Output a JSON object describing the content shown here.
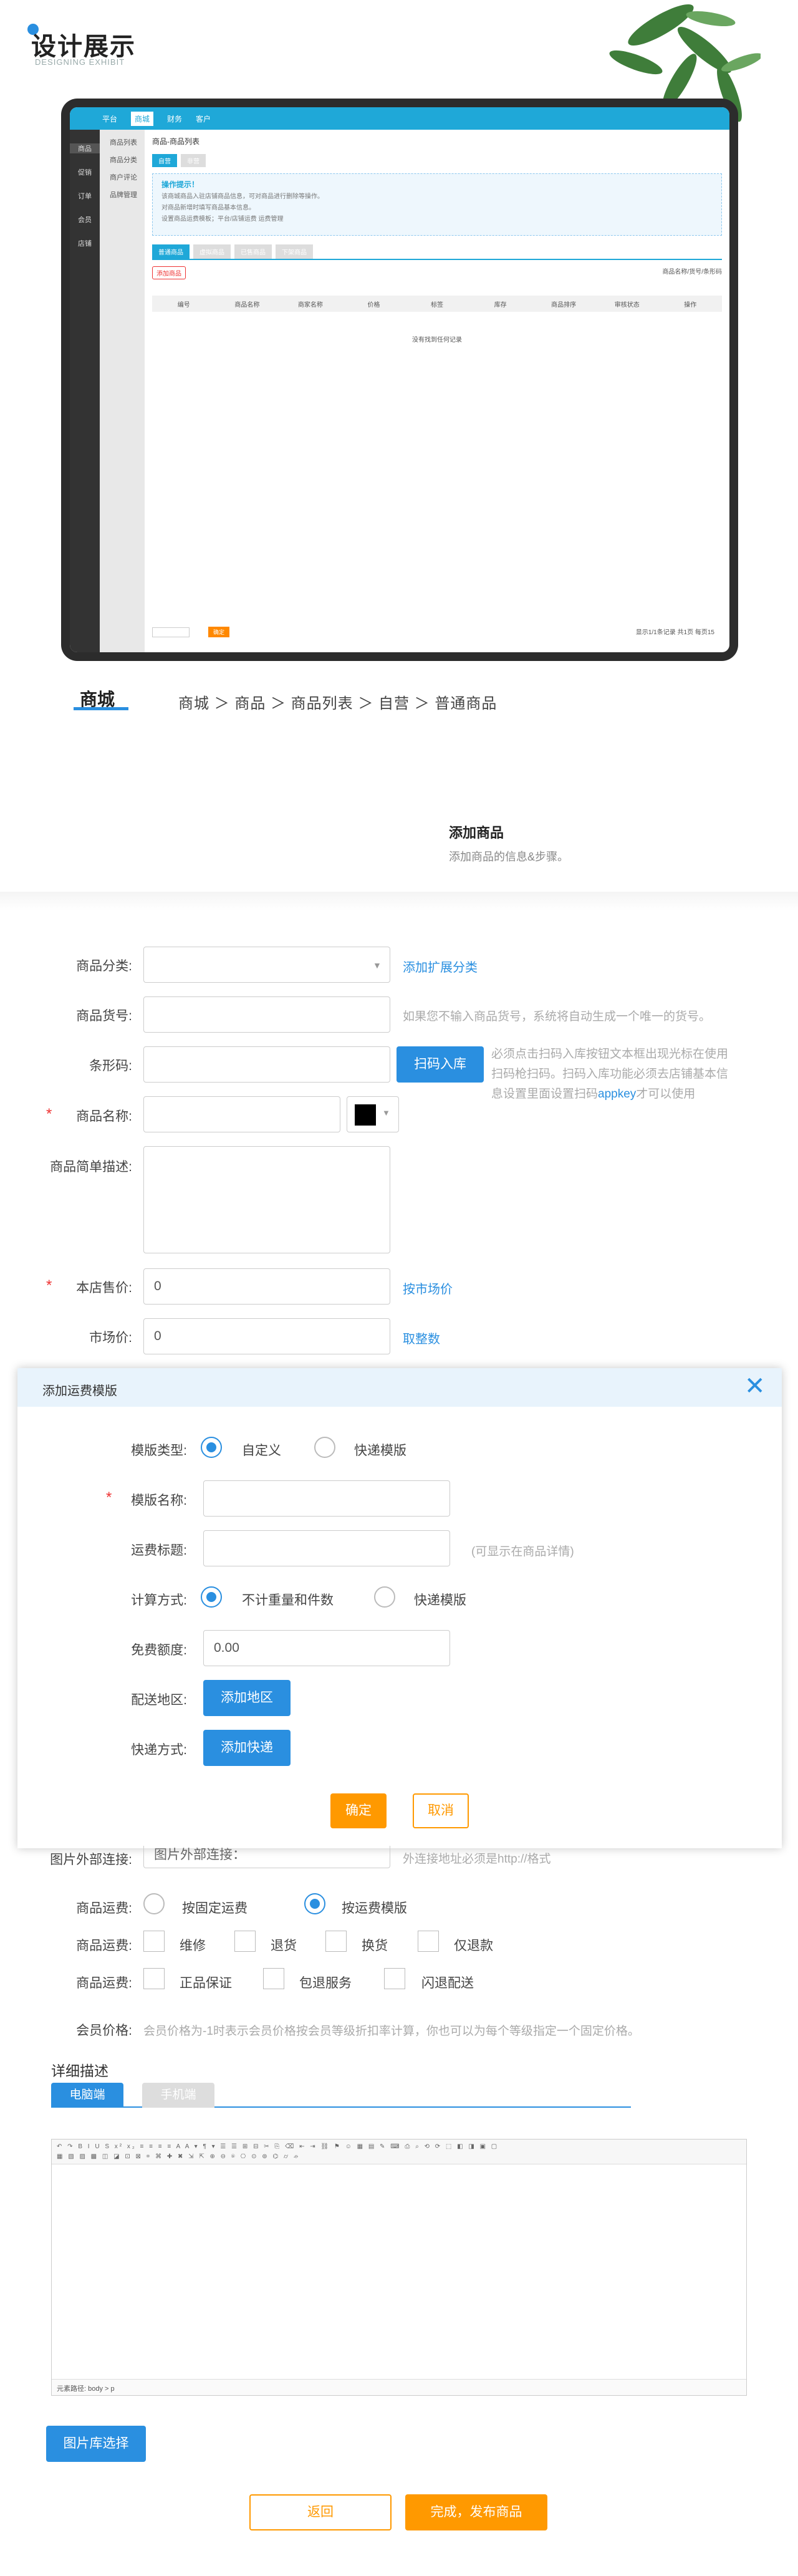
{
  "header": {
    "title": "设计展示",
    "subtitle": "DESIGNING EXHIBIT"
  },
  "mock": {
    "top_nav": [
      "平台",
      "商城",
      "财务",
      "客户"
    ],
    "left_nav": [
      "商品",
      "促销",
      "订单",
      "会员",
      "店铺"
    ],
    "sub_nav": [
      "商品列表",
      "商品分类",
      "商户评论",
      "品牌管理"
    ],
    "page_title": "商品-商品列表",
    "tabs": [
      "自营",
      "非营"
    ],
    "tip_title": "操作提示！",
    "tip_lines": [
      "该商城商品入驻店铺商品信息，可对商品进行删除等操作。",
      "对商品新增时填写商品基本信息。",
      "设置商品运费模板；平台/店铺运费 运费管理"
    ],
    "list_tabs": [
      "普通商品",
      "虚拟商品",
      "已售商品",
      "下架商品"
    ],
    "add_btn": "添加商品",
    "search_hint": "商品名称/货号/条形码",
    "columns": [
      "编号",
      "商品名称",
      "商家名称",
      "价格",
      "标签",
      "库存",
      "商品排序",
      "审核状态",
      "操作"
    ],
    "empty": "没有找到任何记录",
    "footer_btn": "确定",
    "pager": "显示1/1条记录 共1页 每页15"
  },
  "breadcrumb": {
    "current": "商城",
    "path": "商城 ＞ 商品 ＞ 商品列表 ＞ 自营 ＞ 普通商品"
  },
  "section": {
    "title": "添加商品",
    "subtitle": "添加商品的信息&步骤。"
  },
  "form": {
    "category": {
      "label": "商品分类:",
      "link": "添加扩展分类"
    },
    "sku": {
      "label": "商品货号:",
      "hint": "如果您不输入商品货号，系统将自动生成一个唯一的货号。"
    },
    "barcode": {
      "label": "条形码:",
      "button": "扫码入库",
      "hint1": "必须点击扫码入库按钮文本框出现光标在使用",
      "hint2": "扫码枪扫码。扫码入库功能必须去店铺基本信",
      "hint3": "息设置里面设置扫码",
      "appkey": "appkey",
      "hint4": "才可以使用"
    },
    "name": {
      "label": "商品名称:",
      "color": "#000000"
    },
    "desc": {
      "label": "商品简单描述:"
    },
    "price": {
      "label": "本店售价:",
      "value": "0",
      "link": "按市场价"
    },
    "market": {
      "label": "市场价:",
      "value": "0",
      "link": "取整数"
    },
    "img_link": {
      "label": "图片外部连接:",
      "placeholder": "图片外部连接：",
      "hint": "外连接地址必须是http://格式"
    },
    "shipping": {
      "label": "商品运费:",
      "opt1": "按固定运费",
      "opt2": "按运费模版"
    },
    "service1": {
      "label": "商品运费:",
      "items": [
        "维修",
        "退货",
        "换货",
        "仅退款"
      ]
    },
    "service2": {
      "label": "商品运费:",
      "items": [
        "正品保证",
        "包退服务",
        "闪退配送"
      ]
    },
    "member": {
      "label": "会员价格:",
      "hint": "会员价格为-1时表示会员价格按会员等级折扣率计算，你也可以为每个等级指定一个固定价格。"
    },
    "detail": {
      "title": "详细描述",
      "tab_pc": "电脑端",
      "tab_mobile": "手机端",
      "editor_footer": "元素路径: body > p"
    },
    "gallery_btn": "图片库选择",
    "back_btn": "返回",
    "publish_btn": "完成，发布商品"
  },
  "modal": {
    "title": "添加运费模版",
    "type": {
      "label": "模版类型:",
      "opt1": "自定义",
      "opt2": "快递模版"
    },
    "name": {
      "label": "模版名称:"
    },
    "ship_title": {
      "label": "运费标题:",
      "hint": "(可显示在商品详情)"
    },
    "calc": {
      "label": "计算方式:",
      "opt1": "不计重量和件数",
      "opt2": "快递模版"
    },
    "free": {
      "label": "免费额度:",
      "value": "0.00"
    },
    "area": {
      "label": "配送地区:",
      "button": "添加地区"
    },
    "express": {
      "label": "快递方式:",
      "button": "添加快递"
    },
    "ok": "确定",
    "cancel": "取消"
  }
}
